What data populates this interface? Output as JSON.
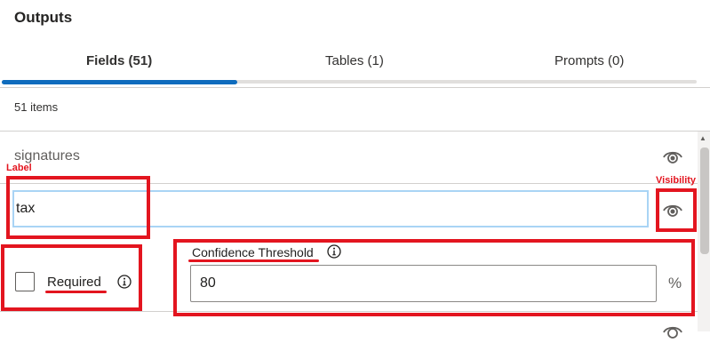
{
  "panel": {
    "title": "Outputs"
  },
  "tabs": [
    {
      "label": "Fields (51)",
      "selected": true
    },
    {
      "label": "Tables (1)",
      "selected": false
    },
    {
      "label": "Prompts (0)",
      "selected": false
    }
  ],
  "list": {
    "count_text": "51 items"
  },
  "previous_field": {
    "name": "signatures",
    "visibility_icon": "eye-icon"
  },
  "current_field": {
    "label_value": "tax",
    "visibility_icon": "eye-icon",
    "required_label": "Required",
    "required_checked": false,
    "confidence_label": "Confidence Threshold",
    "confidence_value": "80",
    "unit": "%"
  },
  "annotations": {
    "label_tag": "Label",
    "visibility_tag": "Visibility",
    "color": "#e3151f"
  },
  "colors": {
    "accent": "#0f6cbd",
    "input_focus": "#a9d4f5"
  }
}
